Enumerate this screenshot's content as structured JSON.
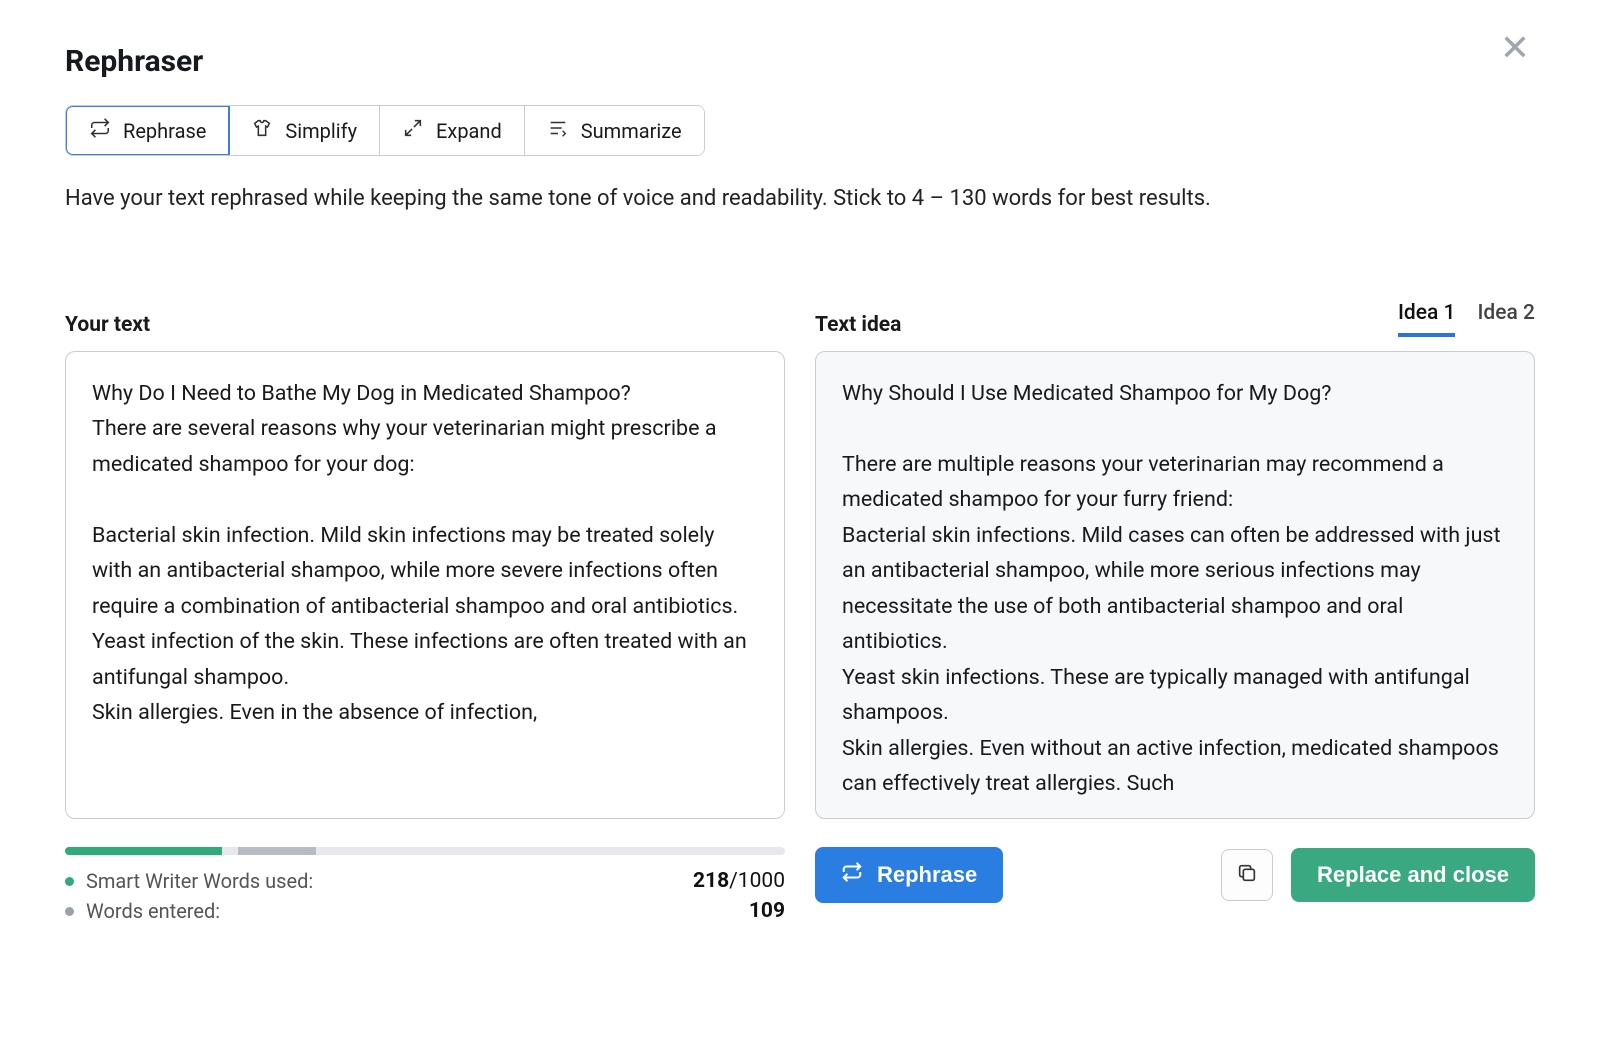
{
  "title": "Rephraser",
  "modes": {
    "rephrase": "Rephrase",
    "simplify": "Simplify",
    "expand": "Expand",
    "summarize": "Summarize"
  },
  "description": "Have your text rephrased while keeping the same tone of voice and readability. Stick to 4 – 130 words for best results.",
  "left": {
    "label": "Your text",
    "p1": "Why Do I Need to Bathe My Dog in Medicated Shampoo?",
    "p2": "There are several reasons why your veterinarian might prescribe a medicated shampoo for your dog:",
    "p3": "Bacterial skin infection. Mild skin infections may be treated solely with an antibacterial shampoo, while more severe infections often require a combination of antibacterial shampoo and oral antibiotics.",
    "p4": "Yeast infection of the skin. These infections are often treated with an antifungal shampoo.",
    "p5": "Skin allergies. Even in the absence of infection,"
  },
  "right": {
    "label": "Text idea",
    "idea1": "Idea 1",
    "idea2": "Idea 2",
    "p1": "Why Should I Use Medicated Shampoo for My Dog?",
    "p2": "There are multiple reasons your veterinarian may recommend a medicated shampoo for your furry friend:",
    "p3": "Bacterial skin infections. Mild cases can often be addressed with just an antibacterial shampoo, while more serious infections may necessitate the use of both antibacterial shampoo and oral antibiotics.",
    "p4": "Yeast skin infections. These are typically managed with antifungal shampoos.",
    "p5": "Skin allergies. Even without an active infection, medicated shampoos can effectively treat allergies. Such"
  },
  "stats": {
    "used_label": "Smart Writer Words used:",
    "used_value": "218",
    "used_max": "/1000",
    "entered_label": "Words entered:",
    "entered_value": "109",
    "progress_green_pct": 21.8,
    "progress_gray_start_pct": 24,
    "progress_gray_width_pct": 10.9
  },
  "buttons": {
    "rephrase": "Rephrase",
    "replace": "Replace and close"
  }
}
